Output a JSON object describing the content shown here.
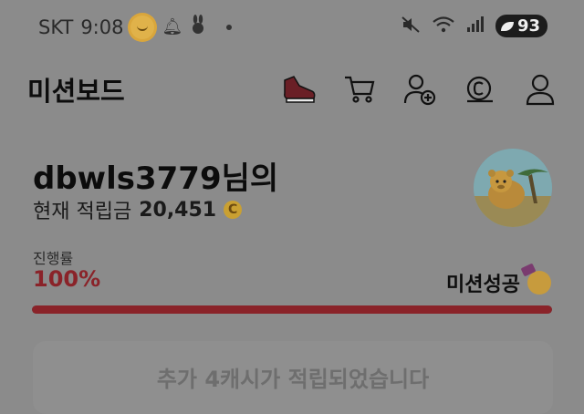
{
  "status": {
    "carrier": "SKT",
    "time": "9:08",
    "battery": "93",
    "icons": [
      "sun-emoji-icon",
      "bell-icon",
      "rabbit-icon",
      "mute-icon",
      "wifi-icon",
      "signal-icon"
    ]
  },
  "header": {
    "title": "미션보드",
    "actions": [
      "sneaker-icon",
      "cart-icon",
      "add-user-icon",
      "coin-icon",
      "profile-icon"
    ]
  },
  "user": {
    "name": "dbwls3779님의",
    "balance_label": "현재 적립금",
    "balance_value": "20,451",
    "coin_symbol": "C"
  },
  "progress": {
    "label": "진행률",
    "value_text": "100%",
    "value_fraction": 1.0,
    "mission_status": "미션성공",
    "accent_color": "#8a2329"
  },
  "card": {
    "text": "추가 4캐시가 적립되었습니다"
  }
}
